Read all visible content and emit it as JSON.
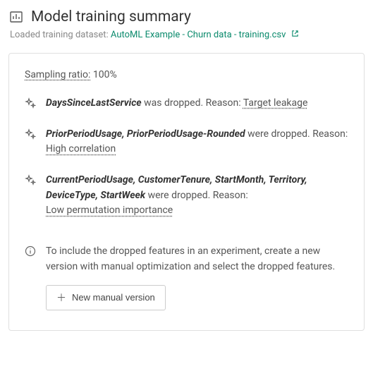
{
  "header": {
    "title": "Model training summary"
  },
  "subheader": {
    "label": "Loaded training dataset:",
    "dataset": "AutoML Example - Churn data - training.csv"
  },
  "panel": {
    "sampling_label": "Sampling ratio:",
    "sampling_value": "100%",
    "drops": [
      {
        "features": "DaysSinceLastService",
        "tail": " was dropped. Reason: ",
        "reason": "Target leakage",
        "reason_inline": true
      },
      {
        "features": "PriorPeriodUsage, PriorPeriodUsage-Rounded",
        "tail": " were dropped. Reason:",
        "reason": "High correlation",
        "reason_inline": false
      },
      {
        "features": "CurrentPeriodUsage, CustomerTenure, StartMonth, Territory, DeviceType, StartWeek",
        "tail": " were dropped. Reason:",
        "reason": "Low permutation importance",
        "reason_inline": false
      }
    ],
    "info_text": "To include the dropped features in an experiment, create a new version with manual optimization and select the dropped features.",
    "button_label": "New manual version"
  }
}
